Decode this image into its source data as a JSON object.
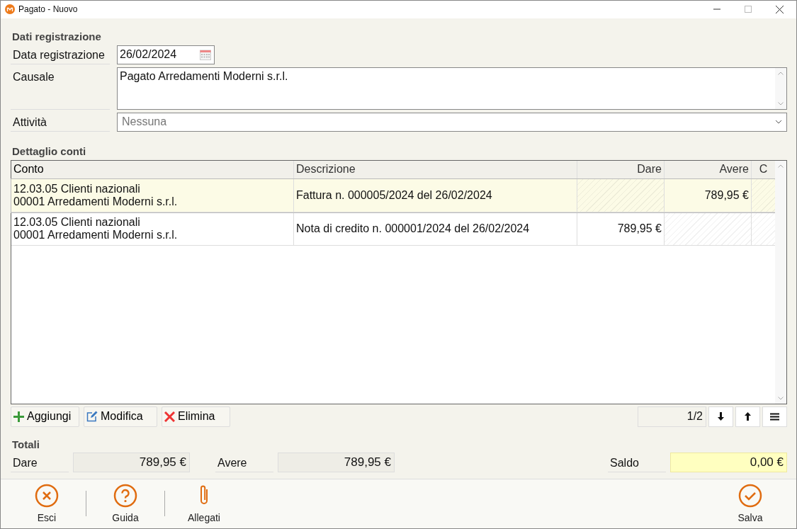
{
  "window": {
    "title": "Pagato - Nuovo"
  },
  "registration": {
    "heading": "Dati registrazione",
    "date": {
      "label": "Data registrazione",
      "value": "26/02/2024"
    },
    "reason": {
      "label": "Causale",
      "value": "Pagato Arredamenti Moderni s.r.l."
    },
    "activity": {
      "label": "Attività",
      "value": "Nessuna"
    }
  },
  "accounts": {
    "heading": "Dettaglio conti",
    "columns": [
      "Conto",
      "Descrizione",
      "Dare",
      "Avere",
      "C"
    ],
    "rows": [
      {
        "selected": true,
        "account": [
          "12.03.05 Clienti nazionali",
          "00001 Arredamenti Moderni s.r.l."
        ],
        "description": "Fattura n. 000005/2024 del 26/02/2024",
        "debit": "",
        "credit": "789,95 €"
      },
      {
        "selected": false,
        "account": [
          "12.03.05 Clienti nazionali",
          "00001 Arredamenti Moderni s.r.l."
        ],
        "description": "Nota di credito n. 000001/2024 del 26/02/2024",
        "debit": "789,95 €",
        "credit": ""
      }
    ],
    "buttons": [
      {
        "kind": "add",
        "label": "Aggiungi"
      },
      {
        "kind": "edit",
        "label": "Modifica"
      },
      {
        "kind": "delete",
        "label": "Elimina"
      }
    ],
    "position": "1/2"
  },
  "totals": {
    "heading": "Totali",
    "debit": {
      "label": "Dare",
      "value": "789,95 €"
    },
    "credit": {
      "label": "Avere",
      "value": "789,95 €"
    },
    "balance": {
      "label": "Saldo",
      "value": "0,00 €"
    }
  },
  "actions": [
    {
      "kind": "exit",
      "label": "Esci"
    },
    {
      "kind": "help",
      "label": "Guida"
    },
    {
      "kind": "attachments",
      "label": "Allegati"
    },
    {
      "kind": "save",
      "label": "Salva"
    }
  ]
}
